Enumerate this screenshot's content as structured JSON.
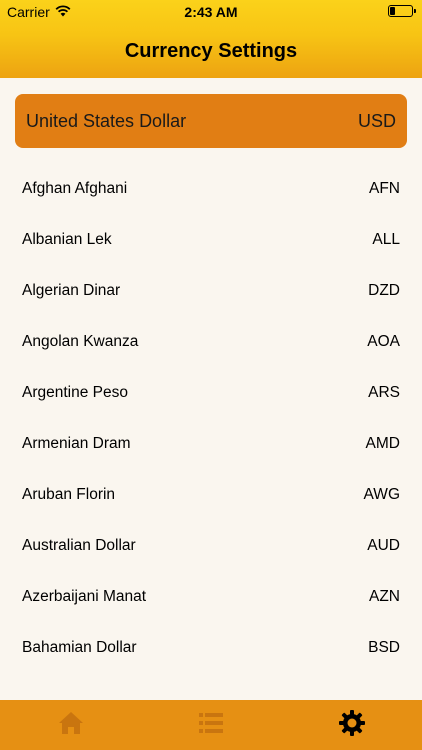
{
  "status_bar": {
    "carrier": "Carrier",
    "time": "2:43 AM"
  },
  "header": {
    "title": "Currency Settings"
  },
  "selected_currency": {
    "name": "United States Dollar",
    "code": "USD"
  },
  "currencies": [
    {
      "name": "Afghan Afghani",
      "code": "AFN"
    },
    {
      "name": "Albanian Lek",
      "code": "ALL"
    },
    {
      "name": "Algerian Dinar",
      "code": "DZD"
    },
    {
      "name": "Angolan Kwanza",
      "code": "AOA"
    },
    {
      "name": "Argentine Peso",
      "code": "ARS"
    },
    {
      "name": "Armenian Dram",
      "code": "AMD"
    },
    {
      "name": "Aruban Florin",
      "code": "AWG"
    },
    {
      "name": "Australian Dollar",
      "code": "AUD"
    },
    {
      "name": "Azerbaijani Manat",
      "code": "AZN"
    },
    {
      "name": "Bahamian Dollar",
      "code": "BSD"
    }
  ],
  "tabbar": {
    "tabs": [
      {
        "icon": "home-icon",
        "active": false
      },
      {
        "icon": "list-icon",
        "active": false
      },
      {
        "icon": "gear-icon",
        "active": true
      }
    ]
  },
  "colors": {
    "header_top": "#fbd21a",
    "header_bottom": "#eda311",
    "selected_bg": "#e17e14",
    "tabbar_bg": "#e69013",
    "background": "#faf6ef",
    "tab_inactive": "#c9750f",
    "tab_active": "#000000"
  }
}
